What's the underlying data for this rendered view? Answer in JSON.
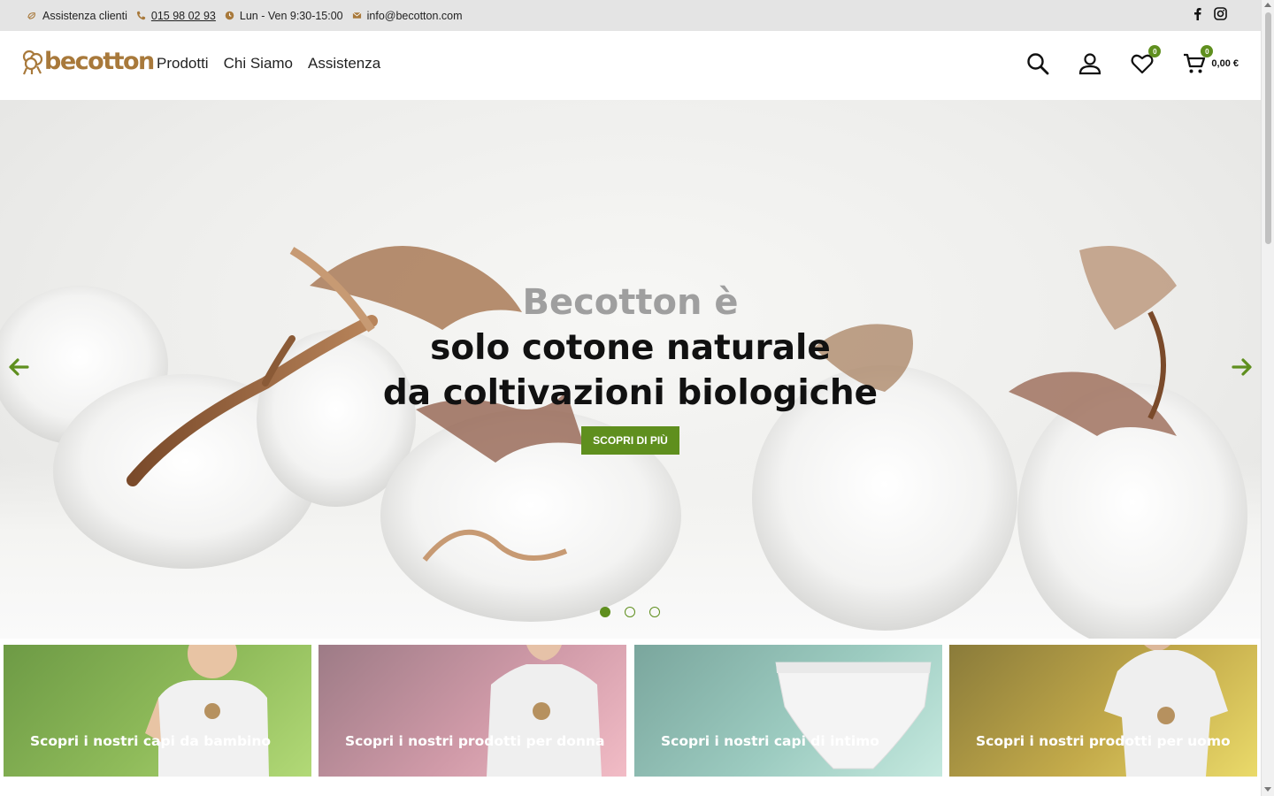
{
  "topbar": {
    "support_label": "Assistenza clienti",
    "phone": "015 98 02 93",
    "hours": "Lun - Ven 9:30-15:00",
    "email": "info@becotton.com",
    "icons": [
      "support-icon",
      "phone-icon",
      "clock-icon",
      "mail-icon",
      "facebook-icon",
      "instagram-icon"
    ]
  },
  "header": {
    "logo_text": "becotton",
    "nav": [
      "Prodotti",
      "Chi Siamo",
      "Assistenza"
    ],
    "wishlist_count": "0",
    "cart_count": "0",
    "cart_total": "0,00 €"
  },
  "hero": {
    "pre_title": "Becotton è",
    "line1": "solo cotone naturale",
    "line2": "da coltivazioni biologiche",
    "button_label": "SCOPRI DI PIÙ",
    "slides": 3,
    "active_slide": 1
  },
  "tiles": [
    {
      "label": "Scopri i nostri capi da bambino"
    },
    {
      "label": "Scopri i nostri prodotti per donna"
    },
    {
      "label": "Scopri i nostri capi di intimo"
    },
    {
      "label": "Scopri i nostri prodotti per uomo"
    }
  ],
  "colors": {
    "accent": "#5f8f1e",
    "brand": "#a8793b",
    "topbar_bg": "#e4e4e4"
  }
}
